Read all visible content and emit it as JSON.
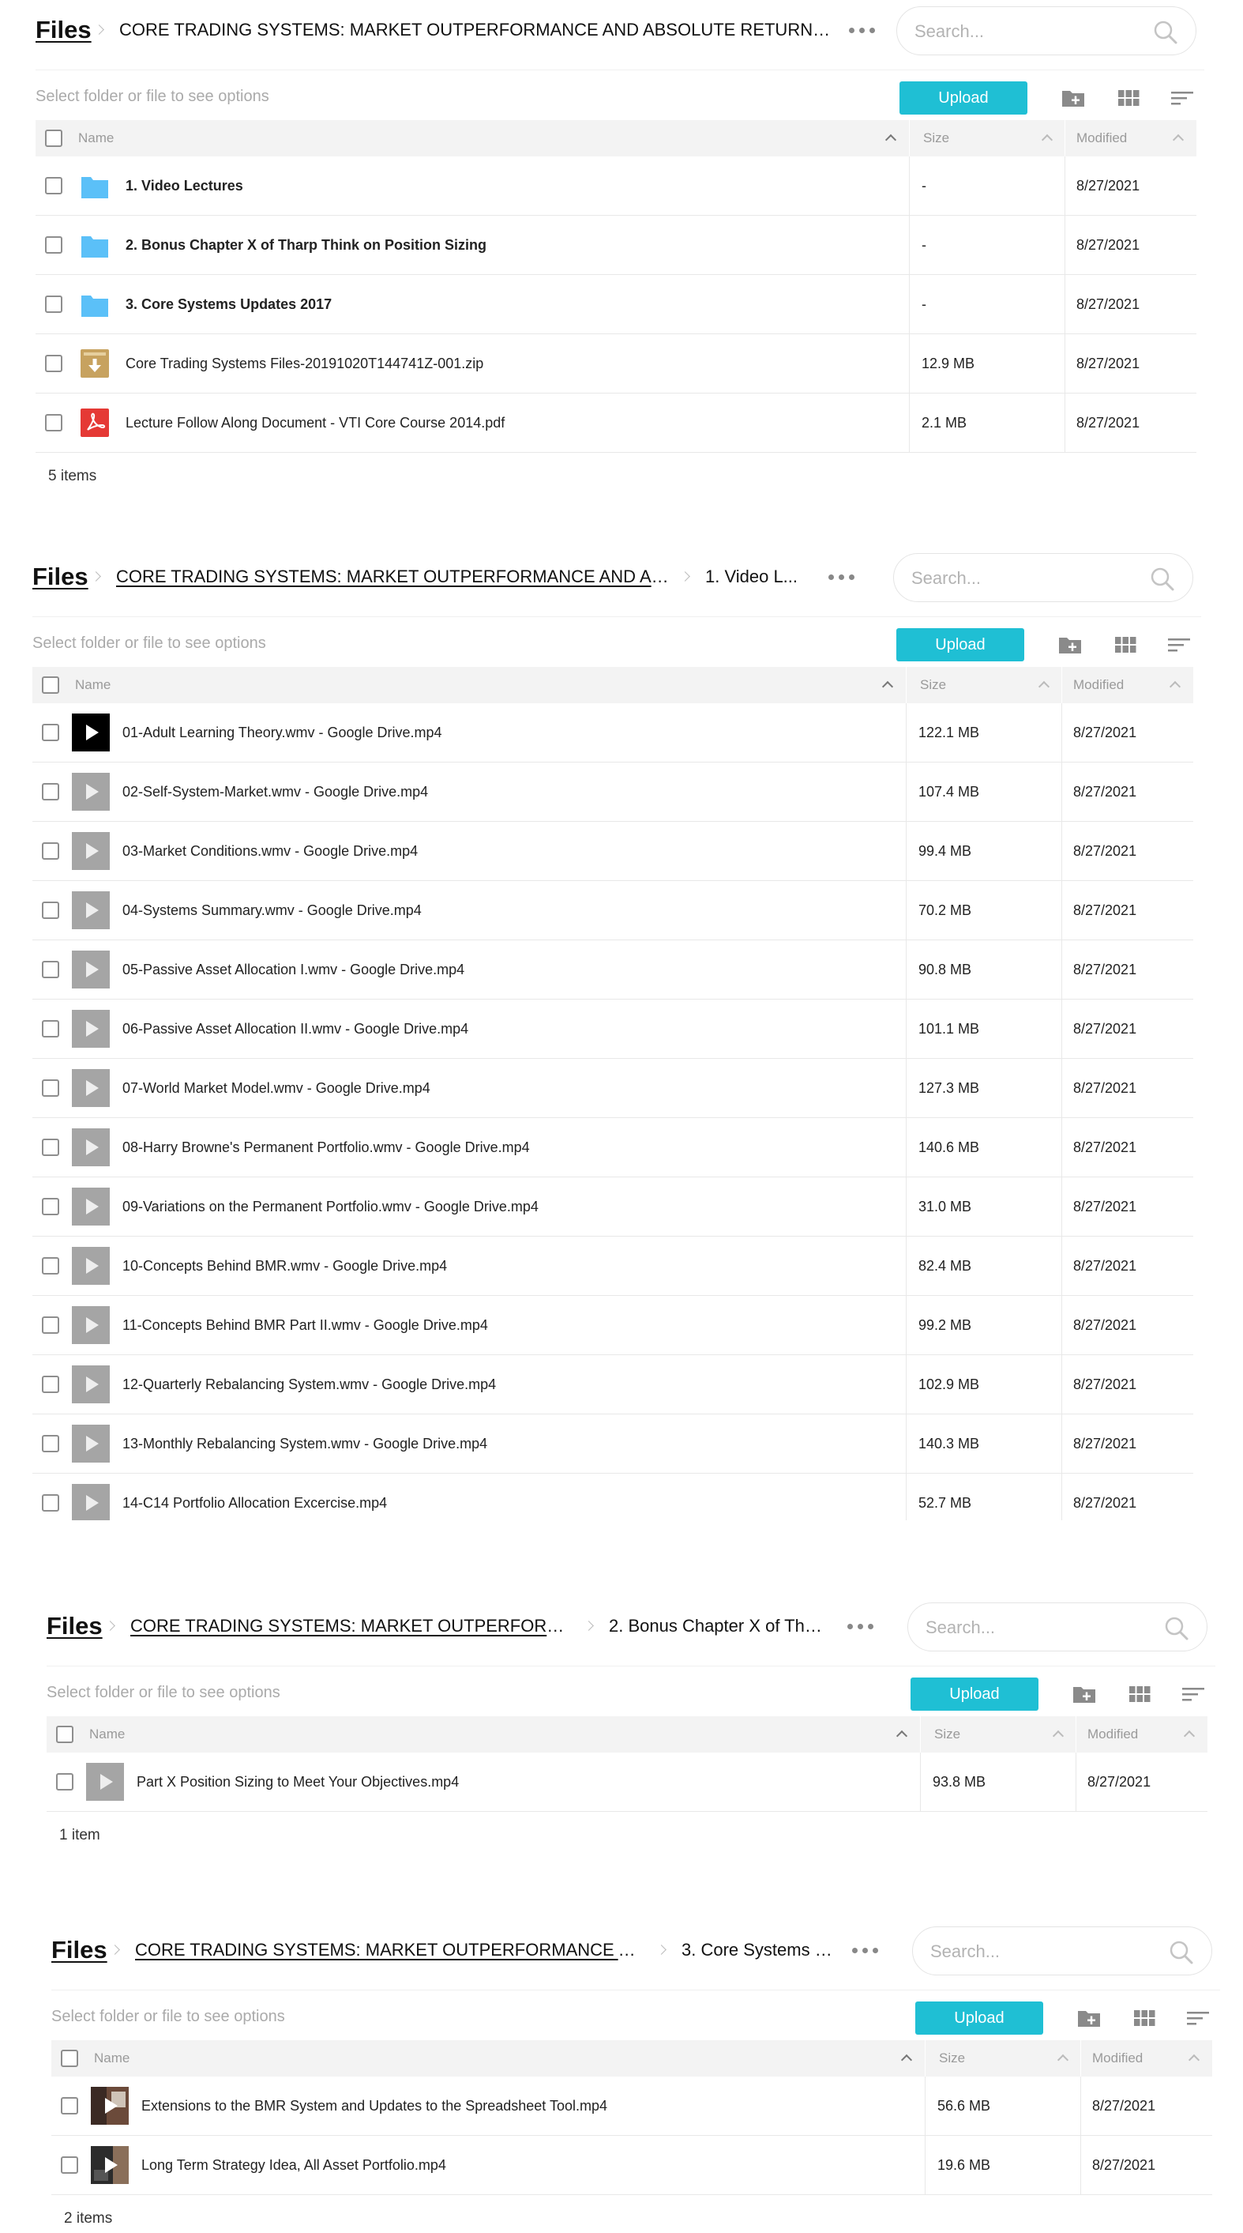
{
  "app": {
    "files_label": "Files",
    "search_placeholder": "Search...",
    "hint": "Select folder or file to see options",
    "upload_label": "Upload",
    "col_name": "Name",
    "col_size": "Size",
    "col_modified": "Modified"
  },
  "panels": [
    {
      "crumbs": [
        "CORE TRADING SYSTEMS: MARKET OUTPERFORMANCE AND ABSOLUTE RETURNS ..."
      ],
      "rows": [
        {
          "name": "1. Video Lectures",
          "size": "-",
          "modified": "8/27/2021",
          "icon": "folder-icon"
        },
        {
          "name": "2. Bonus Chapter X of Tharp Think on Position Sizing",
          "size": "-",
          "modified": "8/27/2021",
          "icon": "folder-icon"
        },
        {
          "name": "3. Core Systems Updates 2017",
          "size": "-",
          "modified": "8/27/2021",
          "icon": "folder-icon"
        },
        {
          "name": "Core Trading Systems Files-20191020T144741Z-001.zip",
          "size": "12.9 MB",
          "modified": "8/27/2021",
          "icon": "archive-icon"
        },
        {
          "name": "Lecture Follow Along Document - VTI Core Course 2014.pdf",
          "size": "2.1 MB",
          "modified": "8/27/2021",
          "icon": "pdf-icon"
        }
      ],
      "footer": "5 items"
    },
    {
      "crumbs": [
        "CORE TRADING SYSTEMS: MARKET OUTPERFORMANCE AND ABSO...",
        "1. Video L..."
      ],
      "rows": [
        {
          "name": "01-Adult Learning Theory.wmv - Google Drive.mp4",
          "size": "122.1 MB",
          "modified": "8/27/2021",
          "icon": "video-dark-icon"
        },
        {
          "name": "02-Self-System-Market.wmv - Google Drive.mp4",
          "size": "107.4 MB",
          "modified": "8/27/2021",
          "icon": "video-icon"
        },
        {
          "name": "03-Market Conditions.wmv - Google Drive.mp4",
          "size": "99.4 MB",
          "modified": "8/27/2021",
          "icon": "video-icon"
        },
        {
          "name": "04-Systems Summary.wmv - Google Drive.mp4",
          "size": "70.2 MB",
          "modified": "8/27/2021",
          "icon": "video-icon"
        },
        {
          "name": "05-Passive Asset Allocation I.wmv - Google Drive.mp4",
          "size": "90.8 MB",
          "modified": "8/27/2021",
          "icon": "video-icon"
        },
        {
          "name": "06-Passive Asset Allocation II.wmv - Google Drive.mp4",
          "size": "101.1 MB",
          "modified": "8/27/2021",
          "icon": "video-icon"
        },
        {
          "name": "07-World Market Model.wmv - Google Drive.mp4",
          "size": "127.3 MB",
          "modified": "8/27/2021",
          "icon": "video-icon"
        },
        {
          "name": "08-Harry Browne's Permanent Portfolio.wmv - Google Drive.mp4",
          "size": "140.6 MB",
          "modified": "8/27/2021",
          "icon": "video-icon"
        },
        {
          "name": "09-Variations on the Permanent Portfolio.wmv - Google Drive.mp4",
          "size": "31.0 MB",
          "modified": "8/27/2021",
          "icon": "video-icon"
        },
        {
          "name": "10-Concepts Behind BMR.wmv - Google Drive.mp4",
          "size": "82.4 MB",
          "modified": "8/27/2021",
          "icon": "video-icon"
        },
        {
          "name": "11-Concepts Behind BMR Part II.wmv - Google Drive.mp4",
          "size": "99.2 MB",
          "modified": "8/27/2021",
          "icon": "video-icon"
        },
        {
          "name": "12-Quarterly Rebalancing System.wmv - Google Drive.mp4",
          "size": "102.9 MB",
          "modified": "8/27/2021",
          "icon": "video-icon"
        },
        {
          "name": "13-Monthly Rebalancing System.wmv - Google Drive.mp4",
          "size": "140.3 MB",
          "modified": "8/27/2021",
          "icon": "video-icon"
        },
        {
          "name": "14-C14 Portfolio Allocation Excercise.mp4",
          "size": "52.7 MB",
          "modified": "8/27/2021",
          "icon": "video-icon"
        }
      ],
      "footer": ""
    },
    {
      "crumbs": [
        "CORE TRADING SYSTEMS: MARKET OUTPERFORMA...",
        "2. Bonus Chapter X of Thar..."
      ],
      "rows": [
        {
          "name": "Part X Position Sizing to Meet Your Objectives.mp4",
          "size": "93.8 MB",
          "modified": "8/27/2021",
          "icon": "video-icon"
        }
      ],
      "footer": "1 item"
    },
    {
      "crumbs": [
        "CORE TRADING SYSTEMS: MARKET OUTPERFORMANCE AND...",
        "3. Core Systems U..."
      ],
      "rows": [
        {
          "name": "Extensions to the BMR System and Updates to the Spreadsheet Tool.mp4",
          "size": "56.6 MB",
          "modified": "8/27/2021",
          "icon": "video-photo-icon"
        },
        {
          "name": "Long Term Strategy Idea, All Asset Portfolio.mp4",
          "size": "19.6 MB",
          "modified": "8/27/2021",
          "icon": "video-photo-icon"
        }
      ],
      "footer": "2 items"
    }
  ]
}
